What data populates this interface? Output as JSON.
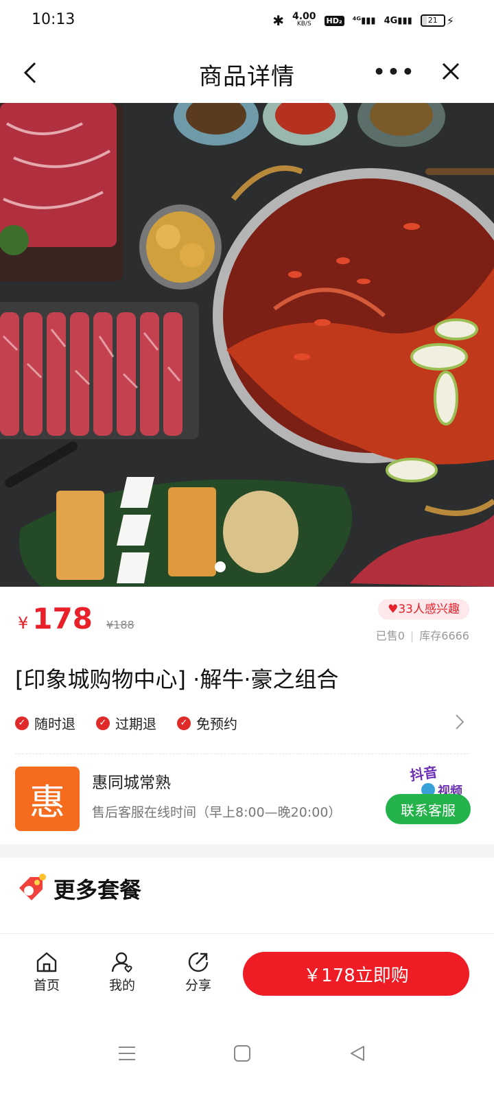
{
  "status_bar": {
    "time": "10:13",
    "speed_value": "4.00",
    "speed_unit": "KB/S",
    "hd_label": "HD₂",
    "signal1": "⁴ᴳ",
    "signal2": "4G",
    "battery": "21"
  },
  "nav": {
    "title": "商品详情",
    "more_label": "•••"
  },
  "product": {
    "price_symbol": "¥",
    "price": "178",
    "original_price": "¥188",
    "interest": "33人感兴趣",
    "sold": "已售0",
    "stock": "库存6666",
    "title": "[印象城购物中心] ·解牛·豪之组合",
    "tags": [
      "随时退",
      "过期退",
      "免预约"
    ]
  },
  "shop": {
    "logo_char": "惠",
    "name": "惠同城常熟",
    "hours": "售后客服在线时间（早上8:00—晚20:00）",
    "badge_line1": "抖音",
    "badge_line2": "视频",
    "contact_label": "联系客服"
  },
  "more_section": {
    "title": "更多套餐"
  },
  "action_bar": {
    "home_label": "首页",
    "mine_label": "我的",
    "share_label": "分享",
    "buy_label": "￥178立即购"
  },
  "colors": {
    "brand_red": "#ee1c24",
    "contact_green": "#24b34a",
    "shop_logo_orange": "#f56c1f"
  },
  "icons": [
    "back-icon",
    "more-icon",
    "close-icon",
    "check-icon",
    "chevron-right-icon",
    "home-icon",
    "user-icon",
    "share-icon",
    "menu-icon",
    "square-icon",
    "back-triangle-icon"
  ]
}
